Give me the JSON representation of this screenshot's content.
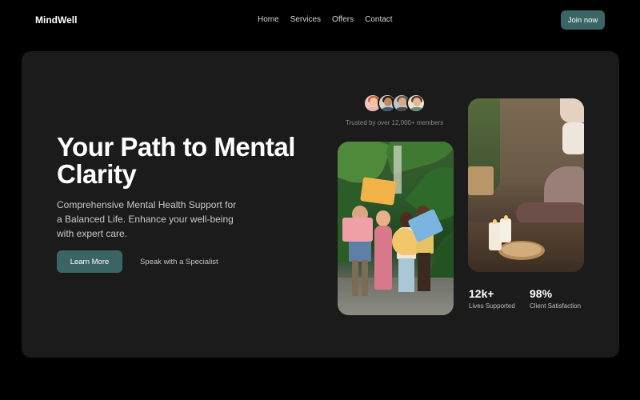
{
  "header": {
    "logo": "MindWell",
    "nav": [
      "Home",
      "Services",
      "Offers",
      "Contact"
    ],
    "cta_label": "Join now"
  },
  "hero": {
    "headline": "Your Path to Mental Clarity",
    "subcopy": "Comprehensive Mental Health Support for a Balanced Life. Enhance your well-being with expert care.",
    "primary_button": "Learn More",
    "secondary_link": "Speak with a Specialist",
    "trust_text": "Trusted by over 12,000+ members"
  },
  "stats": [
    {
      "value": "12k+",
      "label": "Lives Supported"
    },
    {
      "value": "98%",
      "label": "Client Satisfaction"
    }
  ],
  "colors": {
    "accent": "#3b6565",
    "panel": "#1b1b1b",
    "background": "#000000"
  },
  "images": {
    "group_photo": "group-people-holding-signs-photo",
    "yoga_photo": "meditation-candles-photo"
  }
}
